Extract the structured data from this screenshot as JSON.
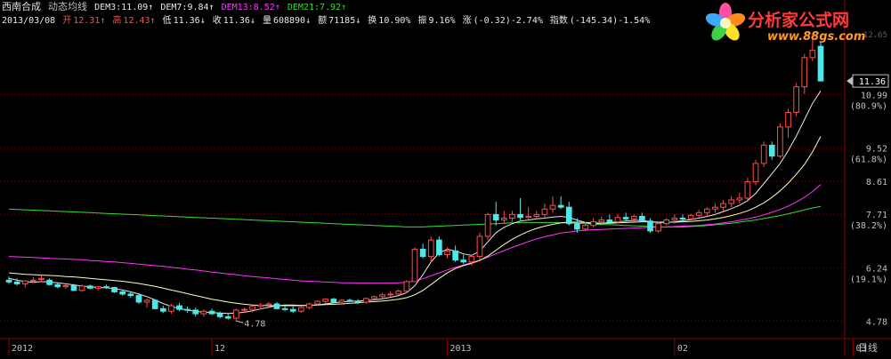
{
  "header": {
    "stock_name": "西南合成",
    "indicator_name": "动态均线",
    "dem3": "DEM3:11.09",
    "dem7": "DEM7:9.84",
    "dem13": "DEM13:8.52",
    "dem21": "DEM21:7.92",
    "date": "2013/03/08",
    "open_label": "开",
    "open_value": "12.31",
    "high_label": "高",
    "high_value": "12.43",
    "low_label": "低",
    "low_value": "11.36",
    "close_label": "收",
    "close_value": "11.36",
    "volume_label": "量",
    "volume_value": "608890",
    "amount_label": "额",
    "amount_value": "71185",
    "turnover_label": "换",
    "turnover_value": "10.90%",
    "amplitude_label": "振",
    "amplitude_value": "9.16%",
    "change_label": "涨",
    "change_value": "(-0.32)-2.74%",
    "index_label": "指数",
    "index_value": "(-145.34)-1.54%"
  },
  "logo": {
    "text": "分析家公式网",
    "url": "www.88gs.com"
  },
  "colors": {
    "up": "#ff4d4d",
    "down": "#4de8e8",
    "dem3": "#e8e8e8",
    "dem7": "#ffffc0",
    "dem13": "#ff33ff",
    "dem21": "#33dd33",
    "grid": "#8b0000",
    "axis_text": "#c0c0c0"
  },
  "chart_data": {
    "type": "candlestick",
    "ylim": [
      4.3,
      12.8
    ],
    "y_ticks": [
      {
        "value": 10.99,
        "label": "10.99",
        "pct": "(80.9%)"
      },
      {
        "value": 9.52,
        "label": "9.52",
        "pct": "(61.8%)"
      },
      {
        "value": 8.61,
        "label": "8.61"
      },
      {
        "value": 7.71,
        "label": "7.71",
        "pct": "(38.2%)"
      },
      {
        "value": 6.24,
        "label": "6.24",
        "pct": "(19.1%)"
      },
      {
        "value": 4.78,
        "label": "4.78"
      }
    ],
    "y_top_label": "12.65",
    "current_price": "11.36",
    "min_marker": {
      "index": 28,
      "value": 4.78,
      "label": "4.78"
    },
    "x_labels": [
      {
        "index": 0,
        "label": "2012"
      },
      {
        "index": 25,
        "label": "12"
      },
      {
        "index": 54,
        "label": "2013"
      },
      {
        "index": 82,
        "label": "02"
      },
      {
        "index": 104,
        "label": "03"
      }
    ],
    "period_label": "日线",
    "candles": [
      [
        5.9,
        6.0,
        5.8,
        5.85
      ],
      [
        5.85,
        5.95,
        5.75,
        5.8
      ],
      [
        5.8,
        5.9,
        5.7,
        5.88
      ],
      [
        5.88,
        5.98,
        5.82,
        5.9
      ],
      [
        5.92,
        6.05,
        5.85,
        5.95
      ],
      [
        5.9,
        5.95,
        5.75,
        5.78
      ],
      [
        5.78,
        5.82,
        5.68,
        5.72
      ],
      [
        5.72,
        5.8,
        5.66,
        5.75
      ],
      [
        5.75,
        5.8,
        5.6,
        5.62
      ],
      [
        5.62,
        5.78,
        5.58,
        5.74
      ],
      [
        5.74,
        5.78,
        5.65,
        5.68
      ],
      [
        5.68,
        5.74,
        5.62,
        5.72
      ],
      [
        5.72,
        5.78,
        5.66,
        5.7
      ],
      [
        5.7,
        5.72,
        5.55,
        5.58
      ],
      [
        5.58,
        5.62,
        5.48,
        5.52
      ],
      [
        5.52,
        5.58,
        5.42,
        5.48
      ],
      [
        5.48,
        5.55,
        5.25,
        5.3
      ],
      [
        5.3,
        5.4,
        5.15,
        5.35
      ],
      [
        5.35,
        5.38,
        5.1,
        5.12
      ],
      [
        5.12,
        5.2,
        5.0,
        5.05
      ],
      [
        5.05,
        5.25,
        4.98,
        5.2
      ],
      [
        5.2,
        5.28,
        5.05,
        5.1
      ],
      [
        5.1,
        5.18,
        5.0,
        5.08
      ],
      [
        5.08,
        5.15,
        4.9,
        4.98
      ],
      [
        4.98,
        5.1,
        4.9,
        5.05
      ],
      [
        5.05,
        5.12,
        4.95,
        4.98
      ],
      [
        4.98,
        5.04,
        4.85,
        4.9
      ],
      [
        4.9,
        4.98,
        4.82,
        4.86
      ],
      [
        4.86,
        5.12,
        4.78,
        5.08
      ],
      [
        5.08,
        5.15,
        5.0,
        5.1
      ],
      [
        5.1,
        5.2,
        5.02,
        5.18
      ],
      [
        5.18,
        5.28,
        5.1,
        5.22
      ],
      [
        5.22,
        5.3,
        5.15,
        5.25
      ],
      [
        5.25,
        5.3,
        5.1,
        5.12
      ],
      [
        5.12,
        5.2,
        5.05,
        5.1
      ],
      [
        5.1,
        5.18,
        5.0,
        5.05
      ],
      [
        5.05,
        5.2,
        5.0,
        5.15
      ],
      [
        5.15,
        5.28,
        5.1,
        5.25
      ],
      [
        5.25,
        5.35,
        5.2,
        5.32
      ],
      [
        5.32,
        5.4,
        5.25,
        5.38
      ],
      [
        5.38,
        5.42,
        5.28,
        5.3
      ],
      [
        5.3,
        5.38,
        5.25,
        5.35
      ],
      [
        5.35,
        5.4,
        5.3,
        5.32
      ],
      [
        5.32,
        5.38,
        5.25,
        5.3
      ],
      [
        5.3,
        5.42,
        5.25,
        5.4
      ],
      [
        5.4,
        5.48,
        5.35,
        5.45
      ],
      [
        5.45,
        5.55,
        5.4,
        5.5
      ],
      [
        5.5,
        5.6,
        5.45,
        5.52
      ],
      [
        5.52,
        5.65,
        5.5,
        5.6
      ],
      [
        5.6,
        5.9,
        5.55,
        5.86
      ],
      [
        5.86,
        6.8,
        5.85,
        6.75
      ],
      [
        6.75,
        6.9,
        6.5,
        6.55
      ],
      [
        6.55,
        7.1,
        6.4,
        7.0
      ],
      [
        7.0,
        7.1,
        6.55,
        6.6
      ],
      [
        6.6,
        6.8,
        6.5,
        6.7
      ],
      [
        6.7,
        6.85,
        6.4,
        6.45
      ],
      [
        6.45,
        6.6,
        6.35,
        6.4
      ],
      [
        6.4,
        6.6,
        6.3,
        6.55
      ],
      [
        6.55,
        7.2,
        6.45,
        7.1
      ],
      [
        7.1,
        7.75,
        7.0,
        7.7
      ],
      [
        7.7,
        8.05,
        7.4,
        7.55
      ],
      [
        7.55,
        7.8,
        7.45,
        7.6
      ],
      [
        7.6,
        7.8,
        7.5,
        7.7
      ],
      [
        7.7,
        8.15,
        7.55,
        7.62
      ],
      [
        7.62,
        7.9,
        7.55,
        7.65
      ],
      [
        7.65,
        7.8,
        7.55,
        7.7
      ],
      [
        7.7,
        8.0,
        7.6,
        7.85
      ],
      [
        7.85,
        8.2,
        7.75,
        7.95
      ],
      [
        7.95,
        8.2,
        7.85,
        7.9
      ],
      [
        7.9,
        8.05,
        7.4,
        7.45
      ],
      [
        7.45,
        7.6,
        7.2,
        7.3
      ],
      [
        7.3,
        7.5,
        7.25,
        7.4
      ],
      [
        7.4,
        7.6,
        7.35,
        7.5
      ],
      [
        7.5,
        7.65,
        7.4,
        7.55
      ],
      [
        7.55,
        7.7,
        7.45,
        7.5
      ],
      [
        7.5,
        7.72,
        7.45,
        7.62
      ],
      [
        7.62,
        7.75,
        7.5,
        7.58
      ],
      [
        7.58,
        7.7,
        7.5,
        7.65
      ],
      [
        7.65,
        7.75,
        7.5,
        7.52
      ],
      [
        7.52,
        7.6,
        7.2,
        7.25
      ],
      [
        7.25,
        7.5,
        7.2,
        7.45
      ],
      [
        7.45,
        7.6,
        7.4,
        7.55
      ],
      [
        7.55,
        7.7,
        7.45,
        7.6
      ],
      [
        7.6,
        7.7,
        7.5,
        7.58
      ],
      [
        7.58,
        7.72,
        7.5,
        7.68
      ],
      [
        7.68,
        7.82,
        7.6,
        7.75
      ],
      [
        7.75,
        7.9,
        7.65,
        7.85
      ],
      [
        7.85,
        8.0,
        7.75,
        7.9
      ],
      [
        7.9,
        8.1,
        7.8,
        8.0
      ],
      [
        8.0,
        8.2,
        7.9,
        8.1
      ],
      [
        8.1,
        8.3,
        8.0,
        8.15
      ],
      [
        8.15,
        8.7,
        8.05,
        8.6
      ],
      [
        8.6,
        9.2,
        8.5,
        9.1
      ],
      [
        9.1,
        9.7,
        9.0,
        9.6
      ],
      [
        9.6,
        9.7,
        9.2,
        9.3
      ],
      [
        9.3,
        10.2,
        9.25,
        10.1
      ],
      [
        10.1,
        10.6,
        9.8,
        10.5
      ],
      [
        10.5,
        11.3,
        10.4,
        11.2
      ],
      [
        11.2,
        12.1,
        11.0,
        12.0
      ],
      [
        12.0,
        12.65,
        11.9,
        12.2
      ],
      [
        12.31,
        12.43,
        11.36,
        11.36
      ]
    ],
    "dem3": [
      5.95,
      5.9,
      5.86,
      5.84,
      5.86,
      5.85,
      5.83,
      5.8,
      5.77,
      5.74,
      5.72,
      5.7,
      5.69,
      5.67,
      5.63,
      5.58,
      5.52,
      5.45,
      5.36,
      5.26,
      5.18,
      5.12,
      5.08,
      5.05,
      5.02,
      5.01,
      5.0,
      4.99,
      5.0,
      5.02,
      5.06,
      5.11,
      5.16,
      5.2,
      5.22,
      5.22,
      5.21,
      5.21,
      5.22,
      5.25,
      5.28,
      5.3,
      5.32,
      5.33,
      5.34,
      5.36,
      5.39,
      5.43,
      5.48,
      5.56,
      5.75,
      6.05,
      6.4,
      6.65,
      6.75,
      6.7,
      6.62,
      6.58,
      6.7,
      6.95,
      7.2,
      7.35,
      7.45,
      7.52,
      7.55,
      7.58,
      7.6,
      7.63,
      7.65,
      7.62,
      7.55,
      7.48,
      7.45,
      7.46,
      7.48,
      7.5,
      7.52,
      7.54,
      7.54,
      7.5,
      7.48,
      7.48,
      7.5,
      7.53,
      7.56,
      7.6,
      7.65,
      7.7,
      7.78,
      7.86,
      7.95,
      8.08,
      8.28,
      8.55,
      8.82,
      9.1,
      9.45,
      9.85,
      10.3,
      10.75,
      11.09
    ],
    "dem7": [
      6.1,
      6.08,
      6.06,
      6.05,
      6.04,
      6.03,
      6.02,
      6.0,
      5.99,
      5.97,
      5.95,
      5.93,
      5.91,
      5.89,
      5.87,
      5.84,
      5.81,
      5.77,
      5.73,
      5.68,
      5.63,
      5.58,
      5.53,
      5.48,
      5.43,
      5.38,
      5.34,
      5.3,
      5.27,
      5.24,
      5.22,
      5.21,
      5.2,
      5.2,
      5.2,
      5.2,
      5.2,
      5.21,
      5.22,
      5.23,
      5.24,
      5.25,
      5.27,
      5.28,
      5.3,
      5.31,
      5.33,
      5.35,
      5.38,
      5.42,
      5.5,
      5.62,
      5.78,
      5.95,
      6.1,
      6.22,
      6.3,
      6.36,
      6.44,
      6.56,
      6.72,
      6.88,
      7.02,
      7.14,
      7.24,
      7.32,
      7.38,
      7.43,
      7.47,
      7.49,
      7.49,
      7.48,
      7.47,
      7.46,
      7.46,
      7.47,
      7.48,
      7.49,
      7.5,
      7.5,
      7.49,
      7.49,
      7.49,
      7.5,
      7.51,
      7.53,
      7.55,
      7.58,
      7.62,
      7.67,
      7.73,
      7.8,
      7.9,
      8.02,
      8.17,
      8.35,
      8.56,
      8.8,
      9.07,
      9.42,
      9.84
    ],
    "dem13": [
      6.55,
      6.54,
      6.53,
      6.52,
      6.51,
      6.5,
      6.49,
      6.48,
      6.47,
      6.46,
      6.44,
      6.43,
      6.41,
      6.4,
      6.38,
      6.36,
      6.34,
      6.32,
      6.3,
      6.28,
      6.25,
      6.23,
      6.2,
      6.18,
      6.15,
      6.12,
      6.1,
      6.07,
      6.05,
      6.02,
      6.0,
      5.98,
      5.96,
      5.94,
      5.92,
      5.9,
      5.88,
      5.87,
      5.86,
      5.85,
      5.84,
      5.83,
      5.83,
      5.82,
      5.82,
      5.82,
      5.82,
      5.82,
      5.83,
      5.84,
      5.88,
      5.94,
      6.02,
      6.1,
      6.18,
      6.25,
      6.32,
      6.38,
      6.45,
      6.53,
      6.62,
      6.71,
      6.8,
      6.88,
      6.96,
      7.03,
      7.09,
      7.14,
      7.19,
      7.22,
      7.25,
      7.27,
      7.28,
      7.29,
      7.3,
      7.31,
      7.32,
      7.33,
      7.34,
      7.35,
      7.35,
      7.36,
      7.37,
      7.38,
      7.39,
      7.4,
      7.42,
      7.44,
      7.47,
      7.5,
      7.54,
      7.58,
      7.63,
      7.69,
      7.76,
      7.84,
      7.93,
      8.04,
      8.17,
      8.33,
      8.52
    ],
    "dem21": [
      7.85,
      7.84,
      7.83,
      7.82,
      7.81,
      7.8,
      7.79,
      7.78,
      7.77,
      7.76,
      7.75,
      7.74,
      7.73,
      7.72,
      7.71,
      7.7,
      7.69,
      7.68,
      7.67,
      7.66,
      7.65,
      7.64,
      7.63,
      7.62,
      7.61,
      7.6,
      7.59,
      7.58,
      7.57,
      7.56,
      7.55,
      7.54,
      7.53,
      7.52,
      7.51,
      7.5,
      7.49,
      7.48,
      7.47,
      7.46,
      7.45,
      7.44,
      7.43,
      7.42,
      7.41,
      7.4,
      7.39,
      7.38,
      7.37,
      7.36,
      7.36,
      7.36,
      7.37,
      7.38,
      7.39,
      7.4,
      7.41,
      7.42,
      7.43,
      7.44,
      7.45,
      7.46,
      7.47,
      7.48,
      7.48,
      7.48,
      7.48,
      7.48,
      7.47,
      7.47,
      7.46,
      7.45,
      7.44,
      7.43,
      7.42,
      7.41,
      7.4,
      7.39,
      7.38,
      7.37,
      7.36,
      7.36,
      7.36,
      7.36,
      7.37,
      7.38,
      7.4,
      7.42,
      7.44,
      7.46,
      7.49,
      7.52,
      7.55,
      7.59,
      7.63,
      7.67,
      7.72,
      7.77,
      7.83,
      7.88,
      7.92
    ]
  }
}
